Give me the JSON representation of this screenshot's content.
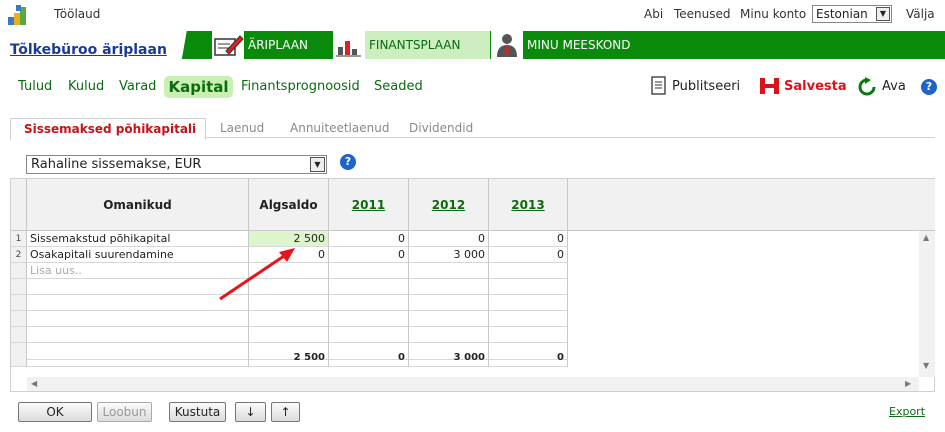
{
  "topbar": {
    "title": "Töölaud",
    "links": [
      "Abi",
      "Teenused",
      "Minu konto"
    ],
    "language": "Estonian",
    "logout": "Välja"
  },
  "company": {
    "name": "Tõlkebüroo äriplaan"
  },
  "nav": {
    "items": [
      {
        "label": "ÄRIPLAAN",
        "icon": "pencil-document-icon"
      },
      {
        "label": "FINANTSPLAAN",
        "icon": "bar-chart-icon"
      },
      {
        "label": "MINU MEESKOND",
        "icon": "person-icon"
      }
    ],
    "active": "FINANTSPLAAN"
  },
  "submenu": {
    "items": [
      "Tulud",
      "Kulud",
      "Varad",
      "Kapital",
      "Finantsprognoosid",
      "Seaded"
    ],
    "active": "Kapital"
  },
  "tools": {
    "publish": "Publitseeri",
    "save": "Salvesta",
    "open": "Ava",
    "help": "?"
  },
  "tabs": {
    "items": [
      "Sissemaksed põhikapitali",
      "Laenud",
      "Annuiteetlaenud",
      "Dividendid"
    ],
    "active": "Sissemaksed põhikapitali"
  },
  "type_select": {
    "value": "Rahaline sissemakse, EUR",
    "help": "?"
  },
  "grid": {
    "headers": {
      "owners": "Omanikud",
      "initial": "Algsaldo",
      "years": [
        "2011",
        "2012",
        "2013"
      ]
    },
    "rows": [
      {
        "num": "1",
        "name": "Sissemakstud põhikapital",
        "initial": "2 500",
        "y2011": "0",
        "y2012": "0",
        "y2013": "0"
      },
      {
        "num": "2",
        "name": "Osakapitali suurendamine",
        "initial": "0",
        "y2011": "0",
        "y2012": "3 000",
        "y2013": "0"
      }
    ],
    "add_placeholder": "Lisa uus..",
    "totals": {
      "initial": "2 500",
      "y2011": "0",
      "y2012": "3 000",
      "y2013": "0"
    }
  },
  "buttons": {
    "ok": "OK",
    "cancel": "Loobun",
    "delete": "Kustuta",
    "down": "↓",
    "up": "↑"
  },
  "export": "Export",
  "colors": {
    "nav_green": "#0a8a0a",
    "link_green": "#0b6b10",
    "active_tab_red": "#c8121a",
    "annotation_arrow": "#e8141a"
  }
}
